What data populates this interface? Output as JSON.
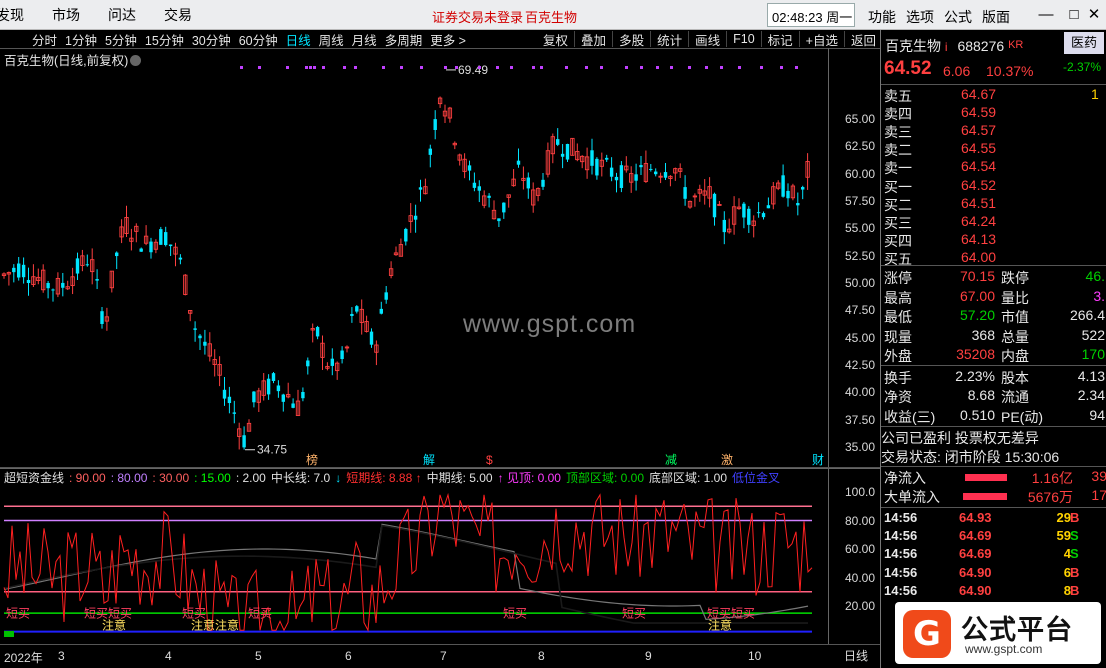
{
  "menubar": {
    "items": [
      "发现",
      "市场",
      "问达",
      "交易"
    ],
    "notice": "证券交易未登录",
    "stock_name": "百克生物",
    "clock": "02:48:23 周一",
    "right_items": [
      "功能",
      "选项",
      "公式",
      "版面"
    ],
    "min_icon": "—",
    "max_icon": "□",
    "close_icon": "✕"
  },
  "toolbar": {
    "periods": [
      "分时",
      "1分钟",
      "5分钟",
      "15分钟",
      "30分钟",
      "60分钟",
      "日线",
      "周线",
      "月线",
      "多周期",
      "更多 >"
    ],
    "active": "日线",
    "actions": [
      "复权",
      "叠加",
      "多股",
      "统计",
      "画线",
      "F10",
      "标记",
      "+自选",
      "返回"
    ]
  },
  "chart": {
    "title": "百克生物(日线,前复权)",
    "high_label": "69.49",
    "low_label": "34.75",
    "watermark": "www.gspt.com",
    "markers": [
      "榜",
      "解",
      "$",
      "减",
      "激",
      "财"
    ],
    "price_ticks": [
      "65.00",
      "62.50",
      "60.00",
      "57.50",
      "55.00",
      "52.50",
      "50.00",
      "47.50",
      "45.00",
      "42.50",
      "40.00",
      "37.50",
      "35.00"
    ],
    "indicator_ticks": [
      "100.0",
      "80.00",
      "60.00",
      "40.00",
      "20.00"
    ],
    "indicator_legend": [
      {
        "text": "超短资金线",
        "color": "#e0e0e0"
      },
      {
        "text": ": 90.00",
        "color": "#ff6060"
      },
      {
        "text": ": 80.00",
        "color": "#c080ff"
      },
      {
        "text": ": 30.00",
        "color": "#ff6060"
      },
      {
        "text": ": 15.00",
        "color": "#00ff00"
      },
      {
        "text": ": 2.00",
        "color": "#e0e0e0"
      },
      {
        "text": "中长线: 7.0",
        "color": "#e0e0e0"
      },
      {
        "text": "↓",
        "color": "#00e5ff"
      },
      {
        "text": "短期线: 8.88 ↑",
        "color": "#ff3030"
      },
      {
        "text": "中期线: 5.00",
        "color": "#e0e0e0"
      },
      {
        "text": "↑ 见顶: 0.00",
        "color": "#ff3cff"
      },
      {
        "text": "顶部区域: 0.00",
        "color": "#00d000"
      },
      {
        "text": "底部区域: 1.00",
        "color": "#e0e0e0"
      },
      {
        "text": "低位金叉",
        "color": "#4040ff"
      }
    ],
    "signal_labels": [
      "短买",
      "短买短买",
      "短买",
      "短买",
      "短买",
      "短买",
      "短买短买"
    ],
    "note_labels": [
      "注意",
      "注意注意",
      "注意"
    ],
    "date_labels": [
      "2022年",
      "3",
      "4",
      "5",
      "6",
      "7",
      "8",
      "9",
      "10"
    ],
    "right_tab": "日线",
    "colors": {
      "up": "#ff4040",
      "down": "#00e5ff",
      "bg": "#000000"
    }
  },
  "quote": {
    "name": "百克生物",
    "flag": "i",
    "code": "688276",
    "market": "KR",
    "badge": "医药",
    "badge_change": "-2.37%",
    "price": "64.52",
    "change": "6.06",
    "change_pct": "10.37%",
    "asks": [
      {
        "label": "卖五",
        "price": "64.67",
        "vol": "1"
      },
      {
        "label": "卖四",
        "price": "64.59",
        "vol": ""
      },
      {
        "label": "卖三",
        "price": "64.57",
        "vol": ""
      },
      {
        "label": "卖二",
        "price": "64.55",
        "vol": ""
      },
      {
        "label": "卖一",
        "price": "64.54",
        "vol": ""
      }
    ],
    "bids": [
      {
        "label": "买一",
        "price": "64.52",
        "vol": ""
      },
      {
        "label": "买二",
        "price": "64.51",
        "vol": ""
      },
      {
        "label": "买三",
        "price": "64.24",
        "vol": ""
      },
      {
        "label": "买四",
        "price": "64.13",
        "vol": ""
      },
      {
        "label": "买五",
        "price": "64.00",
        "vol": ""
      }
    ],
    "stats": [
      {
        "l1": "涨停",
        "v1": "70.15",
        "c1": "red",
        "l2": "跌停",
        "v2": "46.",
        "c2": "green"
      },
      {
        "l1": "最高",
        "v1": "67.00",
        "c1": "red",
        "l2": "量比",
        "v2": "3.",
        "c2": "magenta"
      },
      {
        "l1": "最低",
        "v1": "57.20",
        "c1": "green",
        "l2": "市值",
        "v2": "266.4",
        "c2": "white"
      },
      {
        "l1": "现量",
        "v1": "368",
        "c1": "white",
        "l2": "总量",
        "v2": "522",
        "c2": "white"
      },
      {
        "l1": "外盘",
        "v1": "35208",
        "c1": "red",
        "l2": "内盘",
        "v2": "170",
        "c2": "green"
      },
      {
        "l1": "换手",
        "v1": "2.23%",
        "c1": "white",
        "l2": "股本",
        "v2": "4.13",
        "c2": "white"
      },
      {
        "l1": "净资",
        "v1": "8.68",
        "c1": "white",
        "l2": "流通",
        "v2": "2.34",
        "c2": "white"
      },
      {
        "l1": "收益(三)",
        "v1": "0.510",
        "c1": "white",
        "l2": "PE(动)",
        "v2": "94",
        "c2": "white"
      }
    ],
    "info_line": "公司已盈利 投票权无差异",
    "trade_status": "交易状态: 闭市阶段 15:30:06",
    "flows": [
      {
        "label": "净流入",
        "value": "1.16亿",
        "extra": "39"
      },
      {
        "label": "大单流入",
        "value": "5676万",
        "extra": "17"
      }
    ],
    "ticks": [
      {
        "time": "14:56",
        "price": "64.93",
        "vol": "29",
        "side": "B"
      },
      {
        "time": "14:56",
        "price": "64.69",
        "vol": "59",
        "side": "S"
      },
      {
        "time": "14:56",
        "price": "64.69",
        "vol": "4",
        "side": "S"
      },
      {
        "time": "14:56",
        "price": "64.90",
        "vol": "6",
        "side": "B"
      },
      {
        "time": "14:56",
        "price": "64.90",
        "vol": "8",
        "side": "B"
      }
    ]
  },
  "logo": {
    "mark": "G",
    "title": "公式平台",
    "url": "www.gspt.com"
  }
}
